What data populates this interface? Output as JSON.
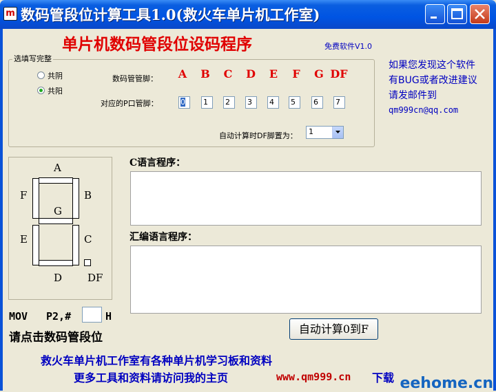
{
  "window": {
    "title": "数码管段位计算工具1.0(救火车单片机工作室)",
    "app_icon": "app-icon",
    "icon_glyph": "m"
  },
  "header": {
    "heading": "单片机数码管段位设码程序",
    "freeware": "免费软件V1.0"
  },
  "options": {
    "group_label": "选填写完整",
    "radios": [
      {
        "label": "共阴",
        "checked": false
      },
      {
        "label": "共阳",
        "checked": true
      }
    ],
    "segment_pin_label": "数码管管脚：",
    "segments": [
      "A",
      "B",
      "C",
      "D",
      "E",
      "F",
      "G",
      "DF"
    ],
    "port_pin_label": "对应的P口管脚：",
    "port_pins": [
      "0",
      "1",
      "2",
      "3",
      "4",
      "5",
      "6",
      "7"
    ],
    "df_label": "自动计算时DF脚置为：",
    "df_value": "1"
  },
  "info": {
    "lines": [
      "如果您发现这个软件",
      "有BUG或者改进建议",
      "请发邮件到"
    ],
    "email": "qm999cn@qq.com"
  },
  "diagram": {
    "labels": {
      "a": "A",
      "b": "B",
      "c": "C",
      "d": "D",
      "e": "E",
      "f": "F",
      "g": "G",
      "df": "DF"
    }
  },
  "code": {
    "c_label": "C语言程序：",
    "asm_label": "汇编语言程序："
  },
  "mov": {
    "op": "MOV",
    "operand": "P2,#",
    "suffix": "H",
    "value": ""
  },
  "hint": "请点击数码管段位",
  "calc_button": "自动计算0到F",
  "footer": {
    "line1": "救火车单片机工作室有各种单片机学习板和资料",
    "line2_pre": "更多工具和资料请访问我的主页",
    "link": "www.qm999.cn",
    "line2_post": "下载"
  },
  "watermark": "eehome.cn"
}
